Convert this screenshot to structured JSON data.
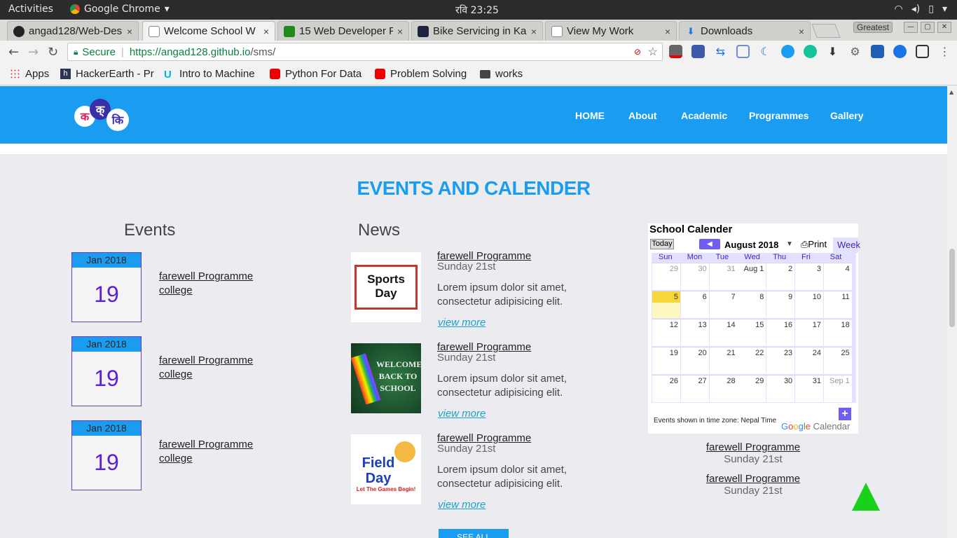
{
  "system": {
    "activities": "Activities",
    "app_name": "Google Chrome",
    "clock": "रवि 23:25"
  },
  "tabs": [
    {
      "title": "angad128/Web-Des",
      "close": "×",
      "icon_color": "#222"
    },
    {
      "title": "Welcome School W",
      "close": "×",
      "icon_color": "#888"
    },
    {
      "title": "15 Web Developer F",
      "close": "×",
      "icon_color": "#1e8a1e"
    },
    {
      "title": "Bike Servicing in Ka",
      "close": "×",
      "icon_color": "#1e2340"
    },
    {
      "title": "View My Work",
      "close": "×",
      "icon_color": "#888"
    },
    {
      "title": "Downloads",
      "close": "×",
      "icon_color": "#1a73e8"
    }
  ],
  "window": {
    "profile": "Greatest"
  },
  "address": {
    "secure_label": "Secure",
    "url_host": "https://angad128.github.io",
    "url_path": "/sms/"
  },
  "bookmarks": [
    {
      "label": "Apps",
      "icon": "apps-grid-icon"
    },
    {
      "label": "HackerEarth - Pr",
      "icon": "hackerearth-icon"
    },
    {
      "label": "Intro to Machine",
      "icon": "udacity-icon"
    },
    {
      "label": "Python For Data",
      "icon": "youtube-icon"
    },
    {
      "label": "Problem Solving",
      "icon": "youtube-icon"
    },
    {
      "label": "works",
      "icon": "folder-icon"
    }
  ],
  "site": {
    "brand_color": "#1a9df0",
    "logo_text": [
      "क",
      "क्",
      "कि"
    ],
    "nav": [
      "HOME",
      "About",
      "Academic",
      "Programmes",
      "Gallery"
    ]
  },
  "section": {
    "title": "EVENTS AND CALENDER",
    "events_heading": "Events",
    "news_heading": "News"
  },
  "events": [
    {
      "month": "Jan 2018",
      "day": "19",
      "line1": "farewell Programme",
      "line2": "college"
    },
    {
      "month": "Jan 2018",
      "day": "19",
      "line1": "farewell Programme",
      "line2": "college"
    },
    {
      "month": "Jan 2018",
      "day": "19",
      "line1": "farewell Programme",
      "line2": "college"
    }
  ],
  "news": [
    {
      "title": "farewell Programme",
      "date": "Sunday 21st",
      "body": "Lorem ipsum dolor sit amet, consectetur adipisicing elit.",
      "more": "view more",
      "thumb_text": "Sports Day"
    },
    {
      "title": "farewell Programme",
      "date": "Sunday 21st",
      "body": "Lorem ipsum dolor sit amet, consectetur adipisicing elit.",
      "more": "view more",
      "thumb_text": "WELCOME BACK TO SCHOOL"
    },
    {
      "title": "farewell Programme",
      "date": "Sunday 21st",
      "body": "Lorem ipsum dolor sit amet, consectetur adipisicing elit.",
      "more": "view more",
      "thumb_text": "Field Day",
      "thumb_sub": "Let The Games Begin!"
    }
  ],
  "see_all": "SEE ALL",
  "calendar": {
    "title": "School Calender",
    "today": "Today",
    "month": "August 2018",
    "print": "Print",
    "week": "Week",
    "day_names": [
      "Sun",
      "Mon",
      "Tue",
      "Wed",
      "Thu",
      "Fri",
      "Sat"
    ],
    "weeks": [
      [
        "29",
        "30",
        "31",
        "Aug 1",
        "2",
        "3",
        "4"
      ],
      [
        "5",
        "6",
        "7",
        "8",
        "9",
        "10",
        "11"
      ],
      [
        "12",
        "13",
        "14",
        "15",
        "16",
        "17",
        "18"
      ],
      [
        "19",
        "20",
        "21",
        "22",
        "23",
        "24",
        "25"
      ],
      [
        "26",
        "27",
        "28",
        "29",
        "30",
        "31",
        "Sep 1"
      ]
    ],
    "timezone": "Events shown in time zone: Nepal Time",
    "google_calendar": "Calendar"
  },
  "calendar_items": [
    {
      "title": "farewell Programme",
      "date": "Sunday 21st"
    },
    {
      "title": "farewell Programme",
      "date": "Sunday 21st"
    }
  ]
}
